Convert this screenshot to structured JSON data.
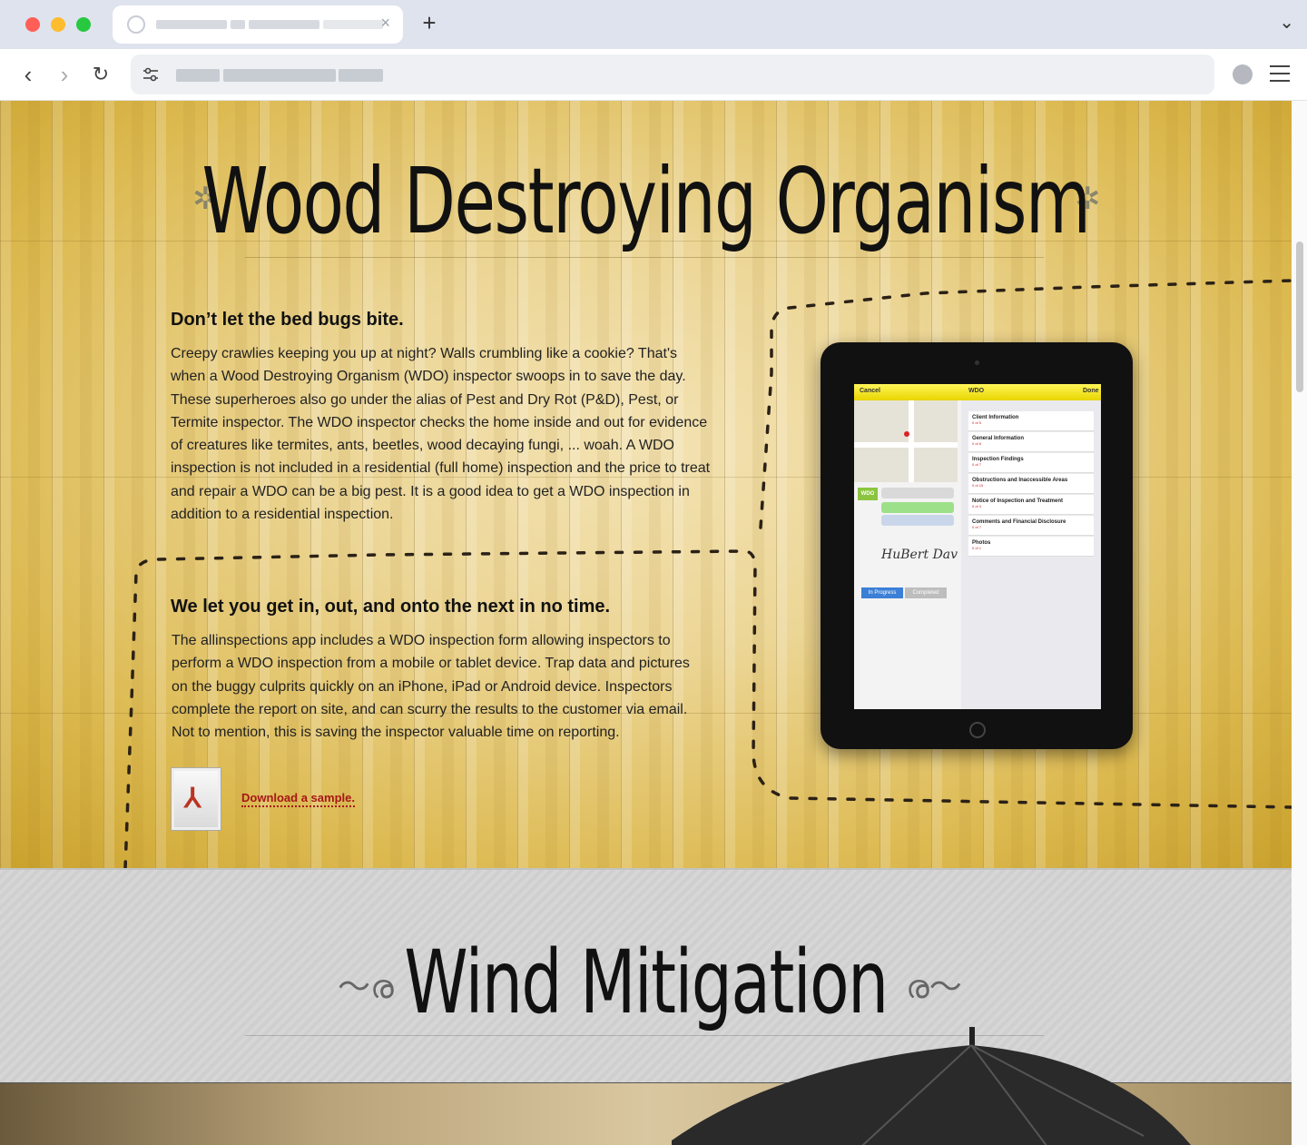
{
  "browser": {
    "new_tab_label": "+",
    "tab_close": "×"
  },
  "wdo": {
    "title": "Wood Destroying Organism",
    "section1": {
      "heading": "Don’t let the bed bugs bite.",
      "lines": [
        "Creepy crawlies keeping you up at night? Walls crumbling like a cookie? That's",
        "when a Wood Destroying Organism (WDO) inspector swoops in to save the day.",
        "These superheroes also go under the alias of Pest and Dry Rot (P&D), Pest, or",
        "Termite inspector. The WDO inspector checks the home inside and out for evidence",
        "of creatures like termites, ants, beetles, wood decaying fungi, ... woah. A WDO",
        "inspection is not included in a residential (full home) inspection and the price to treat",
        "and repair a WDO can be a big pest. It is a good idea to get a WDO inspection in",
        "addition to a residential inspection."
      ]
    },
    "section2": {
      "heading": "We let you get in, out, and onto the next in no time.",
      "lines": [
        "The allinspections app includes a WDO inspection form allowing inspectors to",
        "perform a WDO inspection from a mobile or tablet device. Trap data and pictures",
        "on the buggy culprits quickly on an iPhone, iPad or Android device. Inspectors",
        "complete the report on site, and can scurry the results to the customer via email.",
        "Not to mention, this is saving the inspector valuable time on reporting."
      ]
    },
    "download_label": "Download a sample.",
    "ipad": {
      "nav_left": "Cancel",
      "nav_title": "WDO",
      "nav_right": "Done",
      "badge": "WDO",
      "signature": "HuBert Dav",
      "tab_active": "In Progress",
      "tab_inactive": "Completed",
      "list": [
        {
          "label": "Client Information",
          "sub": "0 of 5"
        },
        {
          "label": "General Information",
          "sub": "0 of 8"
        },
        {
          "label": "Inspection Findings",
          "sub": "0 of 7"
        },
        {
          "label": "Obstructions and Inaccessible Areas",
          "sub": "0 of 15"
        },
        {
          "label": "Notice of Inspection and Treatment",
          "sub": "0 of 3"
        },
        {
          "label": "Comments and Financial Disclosure",
          "sub": "0 of 7"
        },
        {
          "label": "Photos",
          "sub": "0 of 1"
        }
      ]
    }
  },
  "wind": {
    "title": "Wind Mitigation"
  },
  "colors": {
    "wood": "#ecd696",
    "link": "#a51717",
    "wind_bg": "#d3d3d3"
  }
}
